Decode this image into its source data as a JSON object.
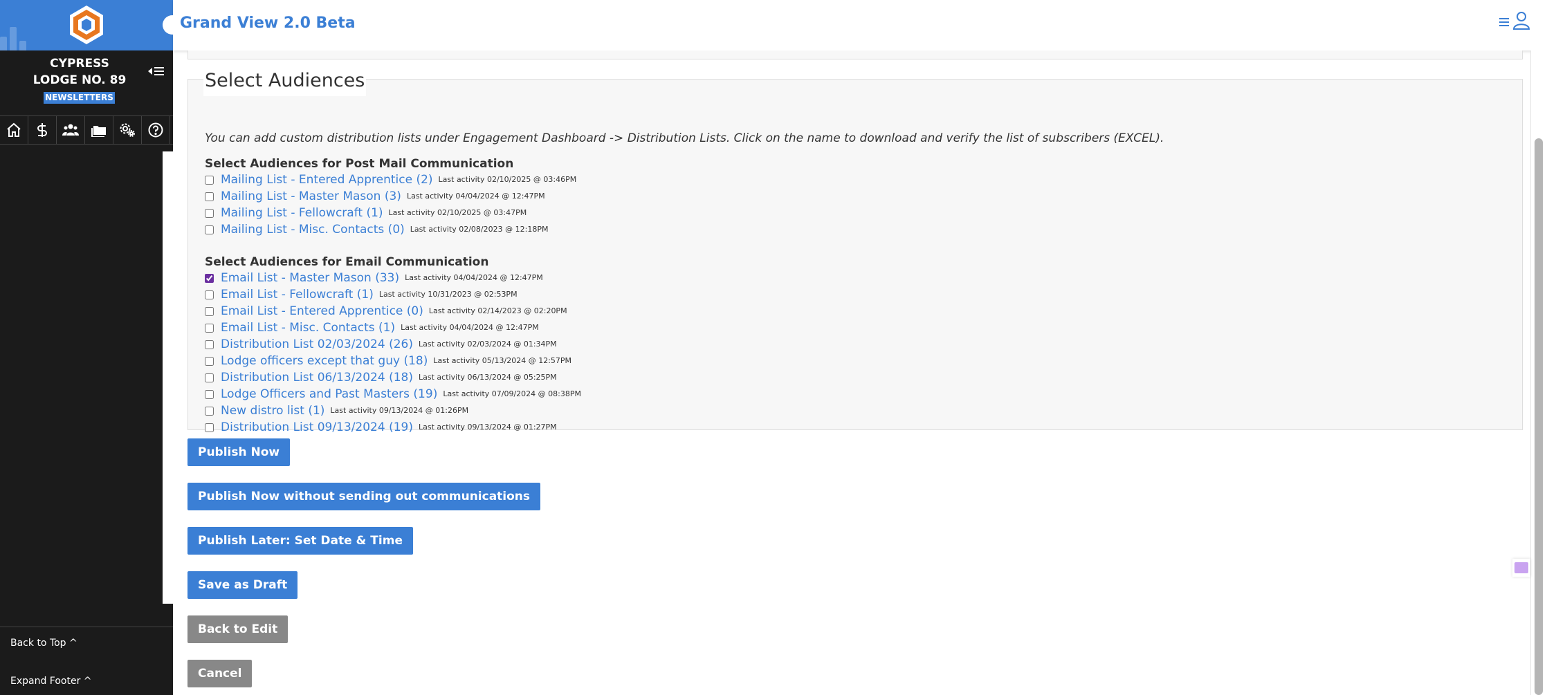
{
  "app": {
    "title": "Grand View 2.0 Beta"
  },
  "sidebar": {
    "lodge_line1": "CYPRESS",
    "lodge_line2": "LODGE NO. 89",
    "section_badge": "NEWSLETTERS",
    "icons": [
      "home-icon",
      "dollar-icon",
      "members-icon",
      "folder-icon",
      "settings-icon",
      "help-icon"
    ],
    "back_to_top": "Back to Top ^",
    "expand_footer": "Expand Footer ^"
  },
  "main": {
    "section_title": "Select Audiences",
    "note": "You can add custom distribution lists under Engagement Dashboard -> Distribution Lists. Click on the name to download and verify the list of subscribers (EXCEL).",
    "post_mail": {
      "title": "Select Audiences for Post Mail Communication",
      "items": [
        {
          "label": "Mailing List - Entered Apprentice (2)",
          "meta": "Last activity 02/10/2025 @ 03:46PM",
          "checked": false
        },
        {
          "label": "Mailing List - Master Mason (3)",
          "meta": "Last activity 04/04/2024 @ 12:47PM",
          "checked": false
        },
        {
          "label": "Mailing List - Fellowcraft (1)",
          "meta": "Last activity 02/10/2025 @ 03:47PM",
          "checked": false
        },
        {
          "label": "Mailing List - Misc. Contacts (0)",
          "meta": "Last activity 02/08/2023 @ 12:18PM",
          "checked": false
        }
      ]
    },
    "email": {
      "title": "Select Audiences for Email Communication",
      "items": [
        {
          "label": "Email List - Master Mason (33)",
          "meta": "Last activity 04/04/2024 @ 12:47PM",
          "checked": true
        },
        {
          "label": "Email List - Fellowcraft (1)",
          "meta": "Last activity 10/31/2023 @ 02:53PM",
          "checked": false
        },
        {
          "label": "Email List - Entered Apprentice (0)",
          "meta": "Last activity 02/14/2023 @ 02:20PM",
          "checked": false
        },
        {
          "label": "Email List - Misc. Contacts (1)",
          "meta": "Last activity 04/04/2024 @ 12:47PM",
          "checked": false
        },
        {
          "label": "Distribution List 02/03/2024 (26)",
          "meta": "Last activity 02/03/2024 @ 01:34PM",
          "checked": false
        },
        {
          "label": "Lodge officers except that guy (18)",
          "meta": "Last activity 05/13/2024 @ 12:57PM",
          "checked": false
        },
        {
          "label": "Distribution List 06/13/2024 (18)",
          "meta": "Last activity 06/13/2024 @ 05:25PM",
          "checked": false
        },
        {
          "label": "Lodge Officers and Past Masters (19)",
          "meta": "Last activity 07/09/2024 @ 08:38PM",
          "checked": false
        },
        {
          "label": "New distro list (1)",
          "meta": "Last activity 09/13/2024 @ 01:26PM",
          "checked": false
        },
        {
          "label": "Distribution List 09/13/2024 (19)",
          "meta": "Last activity 09/13/2024 @ 01:27PM",
          "checked": false
        }
      ]
    },
    "buttons": {
      "publish_now": "Publish Now",
      "publish_no_comms": "Publish Now without sending out communications",
      "publish_later": "Publish Later: Set Date & Time",
      "save_draft": "Save as Draft",
      "back_to_edit": "Back to Edit",
      "cancel": "Cancel"
    }
  },
  "colors": {
    "accent": "#3b7fd5",
    "sidebar_bg": "#1b1b1b",
    "button_gray": "#888888",
    "logo_orange": "#e8771f"
  }
}
